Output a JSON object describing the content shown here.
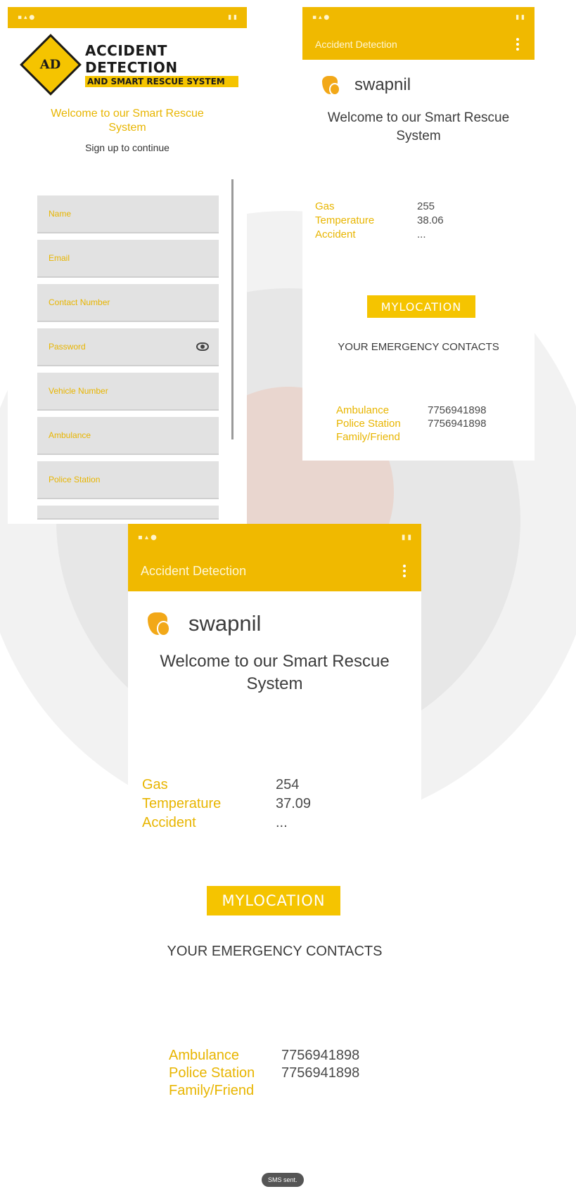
{
  "signup": {
    "logo": {
      "monogram": "AD",
      "line1": "ACCIDENT DETECTION",
      "line2": "AND SMART RESCUE SYSTEM"
    },
    "welcome": "Welcome to our Smart Rescue System",
    "subtitle": "Sign up to continue",
    "fields": {
      "name": "Name",
      "email": "Email",
      "contact": "Contact Number",
      "password": "Password",
      "vehicle": "Vehicle Number",
      "ambulance": "Ambulance",
      "police": "Police Station"
    },
    "password_toggle_icon": "eye-icon"
  },
  "dashboard_small": {
    "app_title": "Accident Detection",
    "username": "swapnil",
    "welcome": "Welcome to our Smart Rescue System",
    "sensors": {
      "gas_label": "Gas",
      "gas_value": "255",
      "temp_label": "Temperature",
      "temp_value": "38.06",
      "accident_label": "Accident",
      "accident_value": "..."
    },
    "location_button": "MYLOCATION",
    "contacts_title": "YOUR EMERGENCY CONTACTS",
    "contacts": {
      "ambulance_label": "Ambulance",
      "ambulance_value": "7756941898",
      "police_label": "Police Station",
      "police_value": "7756941898",
      "family_label": "Family/Friend"
    }
  },
  "dashboard_large": {
    "app_title": "Accident Detection",
    "username": "swapnil",
    "welcome": "Welcome to our Smart Rescue System",
    "sensors": {
      "gas_label": "Gas",
      "gas_value": "254",
      "temp_label": "Temperature",
      "temp_value": "37.09",
      "accident_label": "Accident",
      "accident_value": "..."
    },
    "location_button": "MYLOCATION",
    "contacts_title": "YOUR EMERGENCY CONTACTS",
    "contacts": {
      "ambulance_label": "Ambulance",
      "ambulance_value": "7756941898",
      "police_label": "Police Station",
      "police_value": "7756941898",
      "family_label": "Family/Friend"
    },
    "toast": "SMS sent."
  },
  "colors": {
    "accent": "#f0b900",
    "label_yellow": "#e8b500",
    "text_dark": "#3c3c3c"
  }
}
